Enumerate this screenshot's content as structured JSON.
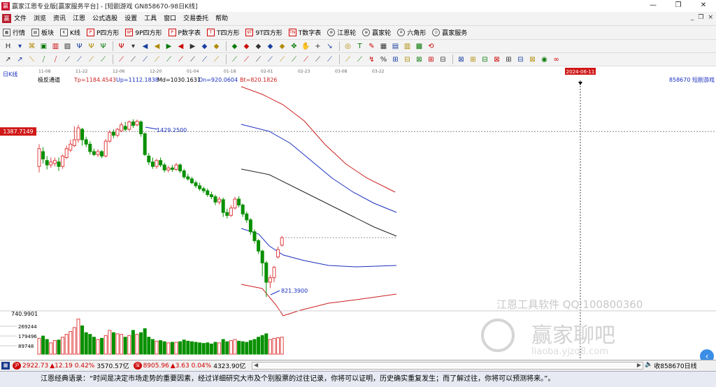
{
  "window": {
    "title": "赢家江恩专业版[赢家服务平台] - [短剧游戏  GN858670-98日K线]",
    "minimize": "—",
    "restore": "❐",
    "close": "✕"
  },
  "menu": {
    "items": [
      "文件",
      "浏览",
      "资讯",
      "江恩",
      "公式选股",
      "设置",
      "工具",
      "窗口",
      "交易委托",
      "帮助"
    ],
    "win_controls": [
      "_",
      "❐",
      "×"
    ]
  },
  "toolbar1": [
    {
      "label": "行情",
      "icon": "grid-icon",
      "ic": "▦"
    },
    {
      "label": "板块",
      "icon": "blocks-icon",
      "ic": "▤"
    },
    {
      "label": "K线",
      "icon": "kline-icon",
      "ic": "K"
    },
    {
      "label": "P四方形",
      "icon": "p-square-icon",
      "ic": "P"
    },
    {
      "label": "9P四方形",
      "icon": "9p-square-icon",
      "ic": "9P"
    },
    {
      "label": "P数字表",
      "icon": "p-table-icon",
      "ic": "P"
    },
    {
      "label": "T四方形",
      "icon": "t-square-icon",
      "ic": "T"
    },
    {
      "label": "9T四方形",
      "icon": "9t-square-icon",
      "ic": "9T"
    },
    {
      "label": "T数字表",
      "icon": "t-table-icon",
      "ic": "TN"
    },
    {
      "label": "江恩轮",
      "icon": "gann-wheel-icon",
      "ic": "⊗"
    },
    {
      "label": "赢家轮",
      "icon": "winner-wheel-icon",
      "ic": "⊕"
    },
    {
      "label": "六角形",
      "icon": "hexagon-icon",
      "ic": "✡"
    },
    {
      "label": "赢家服务",
      "icon": "service-icon",
      "ic": "⊙"
    }
  ],
  "toolbar2": [
    "H",
    "▾",
    "⌘",
    "▣",
    "▥",
    "▨",
    "Ψ",
    "Ψ",
    "Ψ",
    "Ψ",
    "▾",
    "◀",
    "◀",
    "▶",
    "◀",
    "▶",
    "◆",
    "◆",
    "◆",
    "◆",
    "◆",
    "◆",
    "◆",
    "✥",
    "✋",
    "+",
    "↘",
    "◎",
    "T",
    "✎",
    "▦",
    "▤",
    "▥",
    "▩",
    "⟲"
  ],
  "toolbar3": [
    "↗",
    "↗",
    "⟍",
    "⧸",
    "⧸",
    "⟋",
    "⟋",
    "⟋",
    "⟋",
    "⟋",
    "⟋",
    "⟋",
    "⟋",
    "⟋",
    "⟋",
    "⟋",
    "⟋",
    "⟋",
    "⟋",
    "⟋",
    "⟋",
    "⟋",
    "⟋",
    "⟋",
    "⟋",
    "⟋",
    "⟋",
    "⟋",
    "⟋",
    "↯",
    "%",
    "⊞",
    "⊟",
    "⊠",
    "⊞",
    "⊟",
    "⊠",
    "⊞",
    "⊟",
    "⊠",
    "⊞",
    "⊟",
    "⊠",
    "◉",
    "∞"
  ],
  "colors": {
    "up": "#e04040",
    "down": "#089000",
    "upper_band": "#cc1f1f",
    "mid_blue": "#1a2fbf",
    "mid_black": "#222222",
    "price_tag_bg": "#d01818",
    "accent": "#3a8ee6"
  },
  "chart_data": {
    "type": "candlestick",
    "period_label": "日K线",
    "date_ticks": [
      "11-08",
      "11-22",
      "12-06",
      "12-20",
      "01-04",
      "01-18",
      "02-01",
      "02-23",
      "03-08",
      "03-22"
    ],
    "cursor_date": "2024-06-11",
    "cursor_price": "1387.7149",
    "indicator": {
      "name": "极反通道",
      "tp_label": "Tp=1184.4543",
      "up_label": "Up=1112.1838",
      "md_label": "Md=1030.1631",
      "dn_label": "Dn=920.0604",
      "bt_label": "Bt=820.1826"
    },
    "symbol_label": "858670  短剧游戏",
    "high_label": "1429.2500",
    "low_label": "821.3900",
    "volume_max_label": "740.9901",
    "volume_ticks": [
      "269244",
      "179496",
      "89748"
    ],
    "price_range": [
      760,
      1560
    ],
    "volume_range": [
      0,
      740
    ],
    "candles": [
      {
        "o": 1270,
        "c": 1330,
        "h": 1345,
        "l": 1250,
        "v": 280
      },
      {
        "o": 1320,
        "c": 1295,
        "h": 1335,
        "l": 1280,
        "v": 320
      },
      {
        "o": 1290,
        "c": 1275,
        "h": 1305,
        "l": 1260,
        "v": 260
      },
      {
        "o": 1275,
        "c": 1285,
        "h": 1300,
        "l": 1265,
        "v": 200
      },
      {
        "o": 1280,
        "c": 1290,
        "h": 1300,
        "l": 1270,
        "v": 240
      },
      {
        "o": 1285,
        "c": 1270,
        "h": 1300,
        "l": 1255,
        "v": 250
      },
      {
        "o": 1270,
        "c": 1305,
        "h": 1310,
        "l": 1262,
        "v": 300
      },
      {
        "o": 1300,
        "c": 1330,
        "h": 1340,
        "l": 1295,
        "v": 350
      },
      {
        "o": 1325,
        "c": 1345,
        "h": 1360,
        "l": 1318,
        "v": 400
      },
      {
        "o": 1340,
        "c": 1360,
        "h": 1405,
        "l": 1335,
        "v": 470
      },
      {
        "o": 1360,
        "c": 1400,
        "h": 1410,
        "l": 1350,
        "v": 620
      },
      {
        "o": 1395,
        "c": 1360,
        "h": 1400,
        "l": 1340,
        "v": 500
      },
      {
        "o": 1360,
        "c": 1345,
        "h": 1370,
        "l": 1335,
        "v": 380
      },
      {
        "o": 1345,
        "c": 1320,
        "h": 1355,
        "l": 1310,
        "v": 350
      },
      {
        "o": 1320,
        "c": 1310,
        "h": 1330,
        "l": 1305,
        "v": 300
      },
      {
        "o": 1310,
        "c": 1320,
        "h": 1328,
        "l": 1302,
        "v": 260
      },
      {
        "o": 1320,
        "c": 1305,
        "h": 1325,
        "l": 1298,
        "v": 280
      },
      {
        "o": 1305,
        "c": 1355,
        "h": 1362,
        "l": 1300,
        "v": 330
      },
      {
        "o": 1355,
        "c": 1385,
        "h": 1392,
        "l": 1350,
        "v": 420
      },
      {
        "o": 1385,
        "c": 1375,
        "h": 1395,
        "l": 1365,
        "v": 380
      },
      {
        "o": 1375,
        "c": 1395,
        "h": 1400,
        "l": 1368,
        "v": 360
      },
      {
        "o": 1390,
        "c": 1410,
        "h": 1418,
        "l": 1385,
        "v": 350
      },
      {
        "o": 1405,
        "c": 1395,
        "h": 1420,
        "l": 1388,
        "v": 300
      },
      {
        "o": 1395,
        "c": 1420,
        "h": 1425,
        "l": 1390,
        "v": 330
      },
      {
        "o": 1420,
        "c": 1408,
        "h": 1429,
        "l": 1400,
        "v": 420
      },
      {
        "o": 1410,
        "c": 1422,
        "h": 1428,
        "l": 1405,
        "v": 350
      },
      {
        "o": 1420,
        "c": 1380,
        "h": 1425,
        "l": 1370,
        "v": 380
      },
      {
        "o": 1380,
        "c": 1310,
        "h": 1385,
        "l": 1305,
        "v": 450
      },
      {
        "o": 1305,
        "c": 1285,
        "h": 1315,
        "l": 1275,
        "v": 300
      },
      {
        "o": 1285,
        "c": 1270,
        "h": 1300,
        "l": 1262,
        "v": 260
      },
      {
        "o": 1270,
        "c": 1290,
        "h": 1296,
        "l": 1262,
        "v": 230
      },
      {
        "o": 1290,
        "c": 1275,
        "h": 1300,
        "l": 1268,
        "v": 240
      },
      {
        "o": 1275,
        "c": 1258,
        "h": 1282,
        "l": 1250,
        "v": 220
      },
      {
        "o": 1258,
        "c": 1265,
        "h": 1272,
        "l": 1250,
        "v": 200
      },
      {
        "o": 1265,
        "c": 1260,
        "h": 1275,
        "l": 1252,
        "v": 210
      },
      {
        "o": 1260,
        "c": 1275,
        "h": 1282,
        "l": 1255,
        "v": 210
      },
      {
        "o": 1275,
        "c": 1255,
        "h": 1280,
        "l": 1248,
        "v": 220
      },
      {
        "o": 1255,
        "c": 1235,
        "h": 1262,
        "l": 1228,
        "v": 250
      },
      {
        "o": 1235,
        "c": 1228,
        "h": 1245,
        "l": 1222,
        "v": 230
      },
      {
        "o": 1228,
        "c": 1215,
        "h": 1235,
        "l": 1210,
        "v": 220
      },
      {
        "o": 1215,
        "c": 1205,
        "h": 1222,
        "l": 1198,
        "v": 210
      },
      {
        "o": 1205,
        "c": 1195,
        "h": 1215,
        "l": 1188,
        "v": 200
      },
      {
        "o": 1195,
        "c": 1188,
        "h": 1202,
        "l": 1180,
        "v": 190
      },
      {
        "o": 1188,
        "c": 1175,
        "h": 1196,
        "l": 1168,
        "v": 200
      },
      {
        "o": 1175,
        "c": 1168,
        "h": 1185,
        "l": 1160,
        "v": 180
      },
      {
        "o": 1168,
        "c": 1150,
        "h": 1175,
        "l": 1140,
        "v": 210
      },
      {
        "o": 1150,
        "c": 1160,
        "h": 1168,
        "l": 1142,
        "v": 200
      },
      {
        "o": 1158,
        "c": 1115,
        "h": 1165,
        "l": 1100,
        "v": 260
      },
      {
        "o": 1115,
        "c": 1105,
        "h": 1128,
        "l": 1095,
        "v": 220
      },
      {
        "o": 1105,
        "c": 1130,
        "h": 1140,
        "l": 1100,
        "v": 240
      },
      {
        "o": 1130,
        "c": 1160,
        "h": 1168,
        "l": 1125,
        "v": 260
      },
      {
        "o": 1160,
        "c": 1140,
        "h": 1170,
        "l": 1132,
        "v": 230
      },
      {
        "o": 1140,
        "c": 1110,
        "h": 1145,
        "l": 1100,
        "v": 220
      },
      {
        "o": 1110,
        "c": 1090,
        "h": 1118,
        "l": 1080,
        "v": 210
      },
      {
        "o": 1090,
        "c": 1050,
        "h": 1096,
        "l": 1040,
        "v": 240
      },
      {
        "o": 1050,
        "c": 1020,
        "h": 1058,
        "l": 1010,
        "v": 260
      },
      {
        "o": 1020,
        "c": 985,
        "h": 1025,
        "l": 975,
        "v": 300
      },
      {
        "o": 985,
        "c": 945,
        "h": 990,
        "l": 900,
        "v": 330
      },
      {
        "o": 945,
        "c": 880,
        "h": 952,
        "l": 830,
        "v": 360
      },
      {
        "o": 880,
        "c": 895,
        "h": 905,
        "l": 860,
        "v": 260
      },
      {
        "o": 895,
        "c": 930,
        "h": 935,
        "l": 880,
        "v": 280
      },
      {
        "o": 965,
        "c": 990,
        "h": 1000,
        "l": 960,
        "v": 290
      },
      {
        "o": 1005,
        "c": 1030,
        "h": 1036,
        "l": 1000,
        "v": 300
      }
    ],
    "candle_idx": [
      0,
      1,
      2,
      3,
      4,
      5,
      6,
      7,
      8,
      9,
      10,
      11,
      12,
      13,
      14,
      15,
      16,
      17,
      18,
      19,
      20,
      21,
      22,
      23,
      24,
      25,
      26,
      27,
      28,
      29,
      30,
      31,
      32,
      33,
      34,
      35,
      36,
      37,
      38,
      39,
      40,
      41,
      42,
      43,
      44,
      45,
      46,
      47,
      48,
      49,
      50,
      51,
      52,
      53,
      54,
      55,
      56,
      57,
      58,
      59,
      60,
      61,
      62
    ]
  },
  "watermark": {
    "line1": "江恩工具软件  QQ:100800360",
    "brand": "赢家聊吧",
    "url": "liaoba.yjzq8.com"
  },
  "status": {
    "sh_index": "2922.73",
    "sh_change": "▲12.19 0.42%",
    "sh_amount": "3570.57亿",
    "sz_index": "8905.96",
    "sz_change": "▲3.63 0.04%",
    "sz_amount": "4323.90亿",
    "right_text": "收858670日线"
  },
  "quote": "江恩经典语录：“时间是决定市场走势的重要因素，经过详细研究大市及个别股票的过往记录，你将可以证明，历史确实重复发生；而了解过往，你将可以预测将来。”。"
}
